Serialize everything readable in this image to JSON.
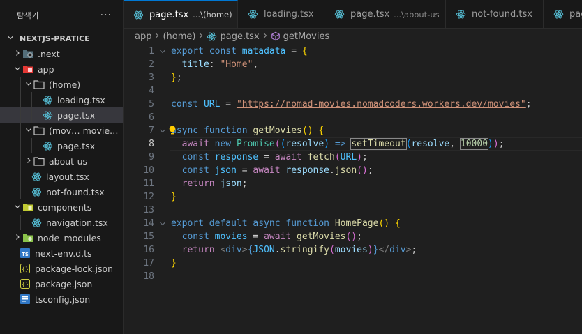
{
  "explorer": {
    "title": "탐색기",
    "more_label": "···",
    "project_name": "NEXTJS-PRATICE"
  },
  "tree": [
    {
      "label": ".next",
      "depth": 0,
      "type": "folder",
      "expanded": false,
      "icon": "next-folder-icon"
    },
    {
      "label": "app",
      "depth": 0,
      "type": "folder",
      "expanded": true,
      "icon": "app-folder-icon"
    },
    {
      "label": "(home)",
      "depth": 1,
      "type": "folder",
      "expanded": true,
      "icon": "folder-icon"
    },
    {
      "label": "loading.tsx",
      "depth": 2,
      "type": "file",
      "icon": "react-icon"
    },
    {
      "label": "page.tsx",
      "depth": 2,
      "type": "file",
      "icon": "react-icon",
      "selected": true
    },
    {
      "label": "(movies)",
      "desc": "movies\\[id]",
      "depth": 1,
      "type": "folder",
      "expanded": true,
      "icon": "folder-icon"
    },
    {
      "label": "page.tsx",
      "depth": 2,
      "type": "file",
      "icon": "react-icon"
    },
    {
      "label": "about-us",
      "depth": 1,
      "type": "folder",
      "expanded": false,
      "icon": "folder-icon"
    },
    {
      "label": "layout.tsx",
      "depth": 1,
      "type": "file",
      "icon": "react-icon"
    },
    {
      "label": "not-found.tsx",
      "depth": 1,
      "type": "file",
      "icon": "react-icon"
    },
    {
      "label": "components",
      "depth": 0,
      "type": "folder",
      "expanded": true,
      "icon": "components-folder-icon"
    },
    {
      "label": "navigation.tsx",
      "depth": 1,
      "type": "file",
      "icon": "react-icon"
    },
    {
      "label": "node_modules",
      "depth": 0,
      "type": "folder",
      "expanded": false,
      "icon": "node-folder-icon"
    },
    {
      "label": "next-env.d.ts",
      "depth": 0,
      "type": "file",
      "icon": "ts-icon"
    },
    {
      "label": "package-lock.json",
      "depth": 0,
      "type": "file",
      "icon": "json-icon"
    },
    {
      "label": "package.json",
      "depth": 0,
      "type": "file",
      "icon": "json-icon"
    },
    {
      "label": "tsconfig.json",
      "depth": 0,
      "type": "file",
      "icon": "tsconfig-icon"
    }
  ],
  "tabs": [
    {
      "label": "page.tsx",
      "desc": "...\\(home)",
      "active": true
    },
    {
      "label": "loading.tsx",
      "desc": "",
      "active": false
    },
    {
      "label": "page.tsx",
      "desc": "...\\about-us",
      "active": false
    },
    {
      "label": "not-found.tsx",
      "desc": "",
      "active": false
    },
    {
      "label": "page",
      "desc": "",
      "active": false
    }
  ],
  "breadcrumb": {
    "items": [
      "app",
      "(home)",
      "page.tsx",
      "getMovies"
    ]
  },
  "editor": {
    "current_line": 8,
    "lines": [
      [
        [
          "kw",
          "export"
        ],
        [
          "pu",
          " "
        ],
        [
          "kw",
          "const"
        ],
        [
          "pu",
          " "
        ],
        [
          "cn",
          "matadata"
        ],
        [
          "pu",
          " = "
        ],
        [
          "b1",
          "{"
        ]
      ],
      [
        [
          "pu",
          "  "
        ],
        [
          "vr",
          "title"
        ],
        [
          "pu",
          ": "
        ],
        [
          "str",
          "\"Home\""
        ],
        [
          "pu",
          ","
        ]
      ],
      [
        [
          "b1",
          "}"
        ],
        [
          "pu",
          ";"
        ]
      ],
      [],
      [
        [
          "kw",
          "const"
        ],
        [
          "pu",
          " "
        ],
        [
          "cn",
          "URL"
        ],
        [
          "pu",
          " = "
        ],
        [
          "str",
          "\"https://nomad-movies.nomadcoders.workers.dev/movies\""
        ],
        [
          "pu",
          ";"
        ]
      ],
      [],
      [
        [
          "kw",
          "async"
        ],
        [
          "pu",
          " "
        ],
        [
          "kw",
          "function"
        ],
        [
          "pu",
          " "
        ],
        [
          "fn",
          "getMovies"
        ],
        [
          "b1",
          "()"
        ],
        [
          "pu",
          " "
        ],
        [
          "b1",
          "{"
        ]
      ],
      [
        [
          "pu",
          "  "
        ],
        [
          "kwc",
          "await"
        ],
        [
          "pu",
          " "
        ],
        [
          "kw",
          "new"
        ],
        [
          "pu",
          " "
        ],
        [
          "ty",
          "Promise"
        ],
        [
          "b2",
          "("
        ],
        [
          "b3",
          "("
        ],
        [
          "vr",
          "resolve"
        ],
        [
          "b3",
          ")"
        ],
        [
          "pu",
          " "
        ],
        [
          "kw",
          "=>"
        ],
        [
          "pu",
          " "
        ],
        [
          "fn",
          "setTimeout"
        ],
        [
          "b3",
          "("
        ],
        [
          "vr",
          "resolve"
        ],
        [
          "pu",
          ", "
        ],
        [
          "num",
          "10000"
        ],
        [
          "b3",
          ")"
        ],
        [
          "b2",
          ")"
        ],
        [
          "pu",
          ";"
        ]
      ],
      [
        [
          "pu",
          "  "
        ],
        [
          "kw",
          "const"
        ],
        [
          "pu",
          " "
        ],
        [
          "cn",
          "response"
        ],
        [
          "pu",
          " = "
        ],
        [
          "kwc",
          "await"
        ],
        [
          "pu",
          " "
        ],
        [
          "fn",
          "fetch"
        ],
        [
          "b2",
          "("
        ],
        [
          "cn",
          "URL"
        ],
        [
          "b2",
          ")"
        ],
        [
          "pu",
          ";"
        ]
      ],
      [
        [
          "pu",
          "  "
        ],
        [
          "kw",
          "const"
        ],
        [
          "pu",
          " "
        ],
        [
          "cn",
          "json"
        ],
        [
          "pu",
          " = "
        ],
        [
          "kwc",
          "await"
        ],
        [
          "pu",
          " "
        ],
        [
          "vr",
          "response"
        ],
        [
          "pu",
          "."
        ],
        [
          "fn",
          "json"
        ],
        [
          "b2",
          "()"
        ],
        [
          "pu",
          ";"
        ]
      ],
      [
        [
          "pu",
          "  "
        ],
        [
          "kwc",
          "return"
        ],
        [
          "pu",
          " "
        ],
        [
          "vr",
          "json"
        ],
        [
          "pu",
          ";"
        ]
      ],
      [
        [
          "b1",
          "}"
        ]
      ],
      [],
      [
        [
          "kw",
          "export"
        ],
        [
          "pu",
          " "
        ],
        [
          "kw",
          "default"
        ],
        [
          "pu",
          " "
        ],
        [
          "kw",
          "async"
        ],
        [
          "pu",
          " "
        ],
        [
          "kw",
          "function"
        ],
        [
          "pu",
          " "
        ],
        [
          "fn",
          "HomePage"
        ],
        [
          "b1",
          "()"
        ],
        [
          "pu",
          " "
        ],
        [
          "b1",
          "{"
        ]
      ],
      [
        [
          "pu",
          "  "
        ],
        [
          "kw",
          "const"
        ],
        [
          "pu",
          " "
        ],
        [
          "cn",
          "movies"
        ],
        [
          "pu",
          " = "
        ],
        [
          "kwc",
          "await"
        ],
        [
          "pu",
          " "
        ],
        [
          "fn",
          "getMovies"
        ],
        [
          "b2",
          "()"
        ],
        [
          "pu",
          ";"
        ]
      ],
      [
        [
          "pu",
          "  "
        ],
        [
          "kwc",
          "return"
        ],
        [
          "pu",
          " "
        ],
        [
          "tg",
          "<"
        ],
        [
          "tgn",
          "div"
        ],
        [
          "tg",
          ">"
        ],
        [
          "kw",
          "{"
        ],
        [
          "cn",
          "JSON"
        ],
        [
          "pu",
          "."
        ],
        [
          "fn",
          "stringify"
        ],
        [
          "b2",
          "("
        ],
        [
          "vr",
          "movies"
        ],
        [
          "b2",
          ")"
        ],
        [
          "kw",
          "}"
        ],
        [
          "tg",
          "</"
        ],
        [
          "tgn",
          "div"
        ],
        [
          "tg",
          ">"
        ],
        [
          "pu",
          ";"
        ]
      ],
      [
        [
          "b1",
          "}"
        ]
      ],
      []
    ]
  },
  "colors": {
    "accent": "#0078d4",
    "react": "#58c4dc",
    "ts": "#3178c6",
    "json": "#cbcb41"
  }
}
